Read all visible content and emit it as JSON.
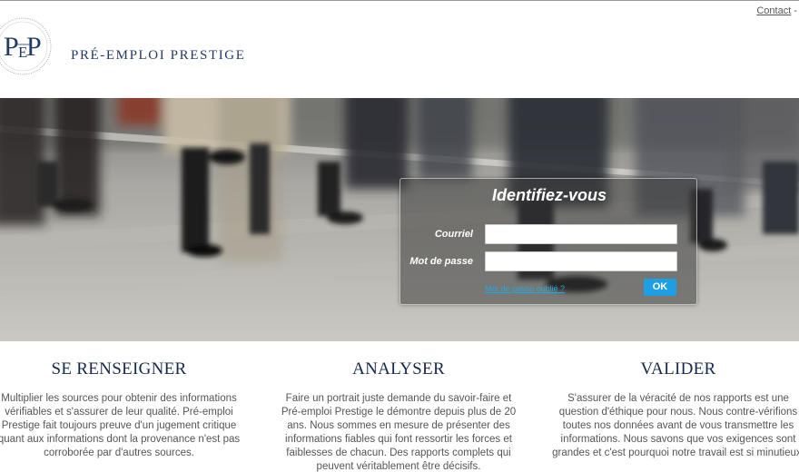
{
  "header": {
    "brand_name": "PRÉ-EMPLOI PRESTIGE",
    "logo_initials": [
      "P",
      "E",
      "P"
    ],
    "contact_link": "Contact",
    "contact_sep": " -"
  },
  "login": {
    "title": "Identifiez-vous",
    "email_label": "Courriel",
    "password_label": "Mot de passe",
    "email_value": "",
    "password_value": "",
    "forgot_link": "Mot de passe oublié ?",
    "ok_button": "OK"
  },
  "sections": [
    {
      "title": "SE RENSEIGNER",
      "text": "Multiplier les sources pour obtenir des informations vérifiables et s'assurer de leur qualité. Pré-emploi Prestige fait toujours preuve d'un jugement critique quant aux informations dont la provenance n'est pas corroborée par d'autres sources."
    },
    {
      "title": "ANALYSER",
      "text": "Faire un portrait juste demande du savoir-faire et Pré-emploi Prestige le démontre depuis plus de 20 ans. Nous sommes en mesure de présenter des informations fiables qui font ressortir les forces et faiblesses de chacun. Des rapports complets qui peuvent véritablement être décisifs."
    },
    {
      "title": "VALIDER",
      "text": "S'assurer de la véracité de nos rapports est une question d'éthique pour nous. Nous contre-vérifions toutes nos données avant de vous transmettre les informations. Nous savons que vos exigences sont grandes et c'est pourquoi notre travail est si minutieux."
    }
  ],
  "colors": {
    "brand_navy": "#233b63",
    "heading_navy": "#15294d",
    "ok_blue": "#1e9ee3",
    "link_blue": "#21a9e1"
  }
}
